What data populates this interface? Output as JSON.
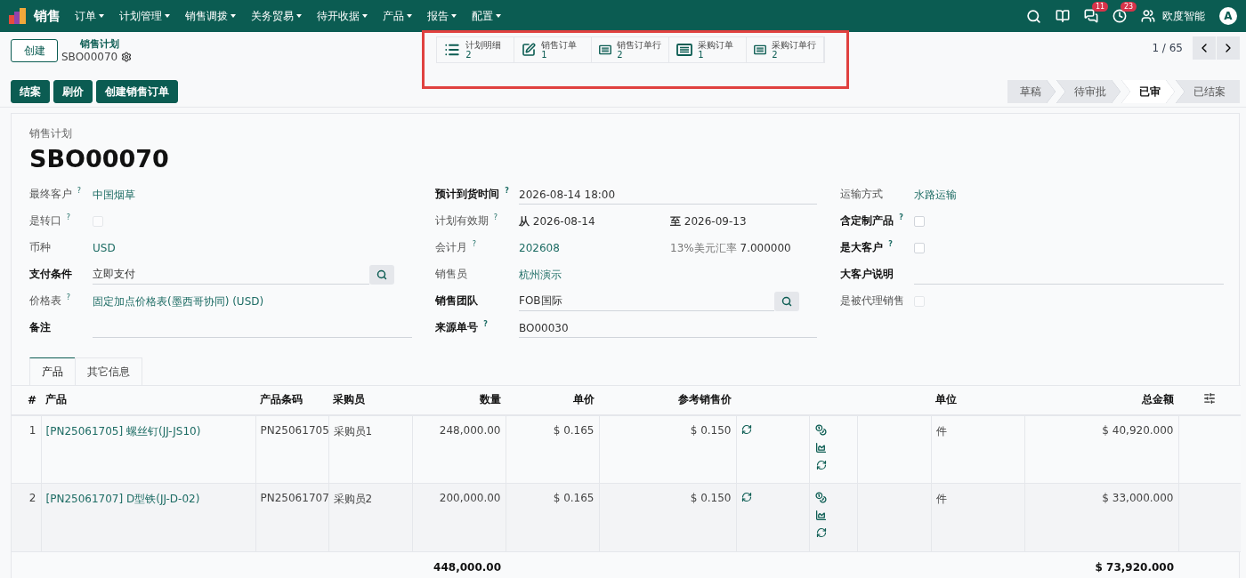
{
  "navbar": {
    "app_name": "销售",
    "menus": [
      "订单",
      "计划管理",
      "销售调拨",
      "关务贸易",
      "待开收据",
      "产品",
      "报告",
      "配置"
    ],
    "systray": {
      "chat_count": "11",
      "activity_count": "23",
      "company": "欧度智能",
      "avatar_text": "A"
    }
  },
  "control_panel": {
    "create_button": "创建",
    "breadcrumb_parent": "销售计划",
    "record_name": "SBO00070",
    "pager": "1 / 65",
    "smart_buttons": [
      {
        "kind": "list",
        "label": "计划明细",
        "count": "2"
      },
      {
        "kind": "edit",
        "label": "销售订单",
        "count": "1"
      },
      {
        "kind": "table",
        "label": "销售订单行",
        "count": "2"
      },
      {
        "kind": "table",
        "label": "采购订单",
        "count": "1"
      },
      {
        "kind": "table",
        "label": "采购订单行",
        "count": "2"
      }
    ],
    "actions": [
      "结案",
      "刷价",
      "创建销售订单"
    ],
    "stages": [
      {
        "label": "草稿",
        "selected": false
      },
      {
        "label": "待审批",
        "selected": false
      },
      {
        "label": "已审",
        "selected": true
      },
      {
        "label": "已结案",
        "selected": false
      }
    ]
  },
  "form": {
    "title_label": "销售计划",
    "title": "SBO00070",
    "columns": [
      [
        {
          "label": "最终客户 $^{?}$",
          "required": false,
          "kind": "link",
          "value": "中国烟草"
        },
        {
          "label": "是转口 $^{?}$",
          "required": false,
          "kind": "checkbox",
          "checked": false,
          "readonly": true
        },
        {
          "label": "币种",
          "required": false,
          "kind": "link",
          "value": "USD"
        },
        {
          "label": "支付条件",
          "required": true,
          "kind": "search",
          "value": "立即支付"
        },
        {
          "label": "价格表 $^{?}$",
          "required": false,
          "kind": "link",
          "value": "固定加点价格表(墨西哥协同) (USD)"
        },
        {
          "label": "备注",
          "required": true,
          "kind": "input"
        }
      ],
      [
        {
          "label": "预计到货时间 $^{?}$",
          "required": true,
          "kind": "input",
          "value": "2026-08-14 18:00"
        },
        {
          "label": "计划有效期 $^{?}$",
          "required": false,
          "kind": "daterange",
          "from_label": "从",
          "from": "2026-08-14",
          "to_label": "至",
          "to": "2026-09-13"
        },
        {
          "label": "会计月 $^{?}$",
          "required": false,
          "kind": "link_note",
          "value": "202608",
          "note_label": "13%美元汇率",
          "note": "7.000000"
        },
        {
          "label": "销售员",
          "required": false,
          "kind": "link",
          "value": "杭州演示"
        },
        {
          "label": "销售团队",
          "required": true,
          "kind": "search",
          "value": "FOB国际"
        },
        {
          "label": "来源单号 $^{?}$",
          "required": true,
          "kind": "input",
          "value": "BO00030"
        }
      ],
      [
        {
          "label": "运输方式",
          "required": false,
          "kind": "link",
          "value": "水路运输"
        },
        {
          "label": "含定制产品 $^{?}$",
          "required": true,
          "kind": "checkbox",
          "checked": false,
          "readonly": false
        },
        {
          "label": "是大客户 $^{?}$",
          "required": true,
          "kind": "checkbox",
          "checked": false,
          "readonly": false
        },
        {
          "label": "大客户说明",
          "required": true,
          "kind": "input"
        },
        {
          "label": "是被代理销售",
          "required": false,
          "kind": "checkbox",
          "checked": false,
          "readonly": true
        }
      ]
    ]
  },
  "notebook": {
    "tabs": [
      {
        "label": "产品",
        "selected": true
      },
      {
        "label": "其它信息",
        "selected": false
      }
    ],
    "table": {
      "columns": [
        {
          "label": "#"
        },
        {
          "label": "产品"
        },
        {
          "label": "产品条码"
        },
        {
          "label": "采购员"
        },
        {
          "label": "数量"
        },
        {
          "label": "单价"
        },
        {
          "label": "参考销售价"
        },
        {
          "label": "单位"
        },
        {
          "label": "总金额"
        }
      ],
      "rows": [
        {
          "cells": [
            "1",
            "[PN25061705] 螺丝钉(JJ-JS10)",
            "PN25061705",
            "采购员1",
            "248,000.00",
            "$ 0.165",
            "$ 0.150",
            "件",
            "$ 40,920.000"
          ]
        },
        {
          "cells": [
            "2",
            "[PN25061707] D型铁(JJ-D-02)",
            "PN25061707",
            "采购员2",
            "200,000.00",
            "$ 0.165",
            "$ 0.150",
            "件",
            "$ 33,000.000"
          ]
        }
      ],
      "totals": {
        "quantity": "448,000.00",
        "amount": "$ 73,920.000"
      }
    }
  }
}
